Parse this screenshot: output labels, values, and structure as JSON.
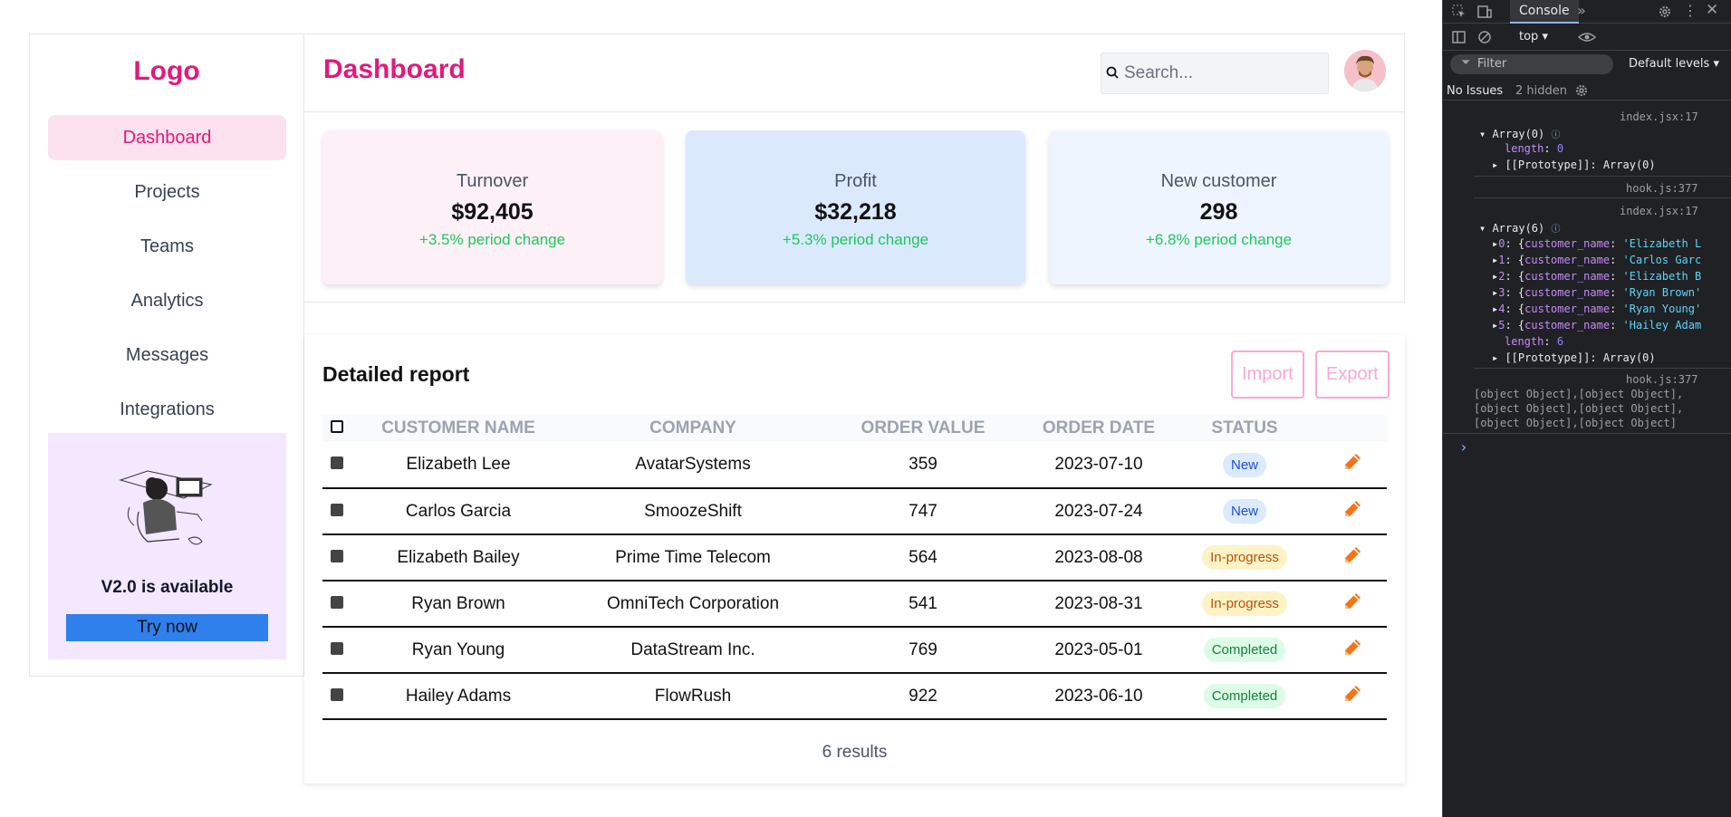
{
  "sidebar": {
    "logo": "Logo",
    "items": [
      {
        "label": "Dashboard",
        "active": true
      },
      {
        "label": "Projects"
      },
      {
        "label": "Teams"
      },
      {
        "label": "Analytics"
      },
      {
        "label": "Messages"
      },
      {
        "label": "Integrations"
      }
    ],
    "promo": {
      "title": "V2.0 is available",
      "button": "Try now"
    }
  },
  "header": {
    "title": "Dashboard",
    "search_placeholder": "Search..."
  },
  "stats": [
    {
      "label": "Turnover",
      "value": "$92,405",
      "change": "+3.5% period change",
      "bg": "#fdf0f6"
    },
    {
      "label": "Profit",
      "value": "$32,218",
      "change": "+5.3% period change",
      "bg": "#dbe9fd"
    },
    {
      "label": "New customer",
      "value": "298",
      "change": "+6.8% period change",
      "bg": "#eef5ff"
    }
  ],
  "report": {
    "title": "Detailed report",
    "import_label": "Import",
    "export_label": "Export",
    "columns": [
      "CUSTOMER NAME",
      "COMPANY",
      "ORDER VALUE",
      "ORDER DATE",
      "STATUS"
    ],
    "rows": [
      {
        "name": "Elizabeth Lee",
        "company": "AvatarSystems",
        "value": "359",
        "date": "2023-07-10",
        "status": "New"
      },
      {
        "name": "Carlos Garcia",
        "company": "SmoozeShift",
        "value": "747",
        "date": "2023-07-24",
        "status": "New"
      },
      {
        "name": "Elizabeth Bailey",
        "company": "Prime Time Telecom",
        "value": "564",
        "date": "2023-08-08",
        "status": "In-progress"
      },
      {
        "name": "Ryan Brown",
        "company": "OmniTech Corporation",
        "value": "541",
        "date": "2023-08-31",
        "status": "In-progress"
      },
      {
        "name": "Ryan Young",
        "company": "DataStream Inc.",
        "value": "769",
        "date": "2023-05-01",
        "status": "Completed"
      },
      {
        "name": "Hailey Adams",
        "company": "FlowRush",
        "value": "922",
        "date": "2023-06-10",
        "status": "Completed"
      }
    ],
    "results": "6 results"
  },
  "status_styles": {
    "New": {
      "bg": "#dbeafe",
      "fg": "#1d4ed8"
    },
    "In-progress": {
      "bg": "#fef3c7",
      "fg": "#b45309"
    },
    "Completed": {
      "bg": "#dcfce7",
      "fg": "#15803d"
    }
  },
  "colors": {
    "brand": "#e01a7c",
    "accent_blue": "#2f80ed",
    "positive": "#22c55e"
  },
  "devtools": {
    "tab": "Console",
    "context": "top",
    "filter": "Filter",
    "levels": "Default levels",
    "issues": "No Issues",
    "hidden": "2 hidden",
    "log1": {
      "source": "index.jsx:17",
      "head": "Array(0)",
      "length_key": "length",
      "length_val": "0",
      "proto": "[[Prototype]]: Array(0)",
      "hook": "hook.js:377"
    },
    "log2": {
      "source": "index.jsx:17",
      "head": "Array(6)",
      "items": [
        {
          "idx": "0",
          "val": "'Elizabeth L"
        },
        {
          "idx": "1",
          "val": "'Carlos Garc"
        },
        {
          "idx": "2",
          "val": "'Elizabeth B"
        },
        {
          "idx": "3",
          "val": "'Ryan Brown'"
        },
        {
          "idx": "4",
          "val": "'Ryan Young'"
        },
        {
          "idx": "5",
          "val": "'Hailey Adam"
        }
      ],
      "item_key": "customer_name",
      "length_key": "length",
      "length_val": "6",
      "proto": "[[Prototype]]: Array(0)",
      "hook": "hook.js:377"
    },
    "log3_lines": [
      "[object Object],[object Object],",
      "[object Object],[object Object],",
      "[object Object],[object Object]"
    ],
    "prompt": "›"
  }
}
